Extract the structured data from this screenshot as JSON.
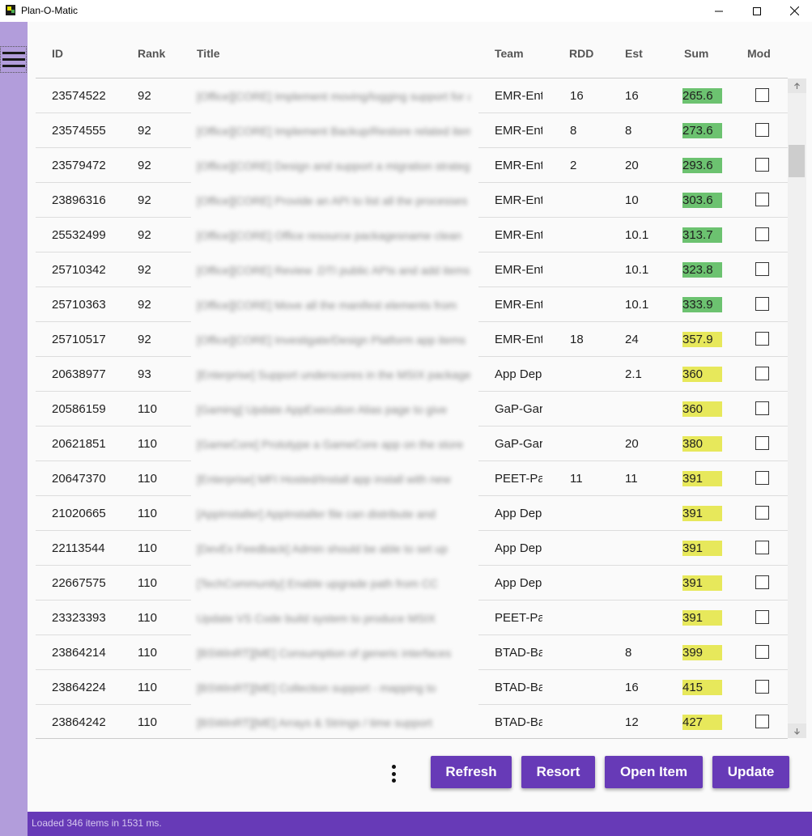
{
  "window": {
    "title": "Plan-O-Matic"
  },
  "columns": {
    "id": "ID",
    "rank": "Rank",
    "title": "Title",
    "team": "Team",
    "rdd": "RDD",
    "est": "Est",
    "sum": "Sum",
    "mod": "Mod"
  },
  "colors": {
    "accent": "#673ab7",
    "sidebar": "#b29ddb",
    "sum_green": "#6cc270",
    "sum_yellow": "#e7e85b"
  },
  "rows": [
    {
      "id": "23574522",
      "rank": "92",
      "title": "[Office][CORE] Implement moving/logging support for all",
      "team": "EMR-Ent",
      "rdd": "16",
      "est": "16",
      "sum": "265.6",
      "sum_color": "green",
      "mod": false
    },
    {
      "id": "23574555",
      "rank": "92",
      "title": "[Office][CORE] Implement Backup/Restore related items",
      "team": "EMR-Ent",
      "rdd": "8",
      "est": "8",
      "sum": "273.6",
      "sum_color": "green",
      "mod": false
    },
    {
      "id": "23579472",
      "rank": "92",
      "title": "[Office][CORE] Design and support a migration strategy",
      "team": "EMR-Ent",
      "rdd": "2",
      "est": "20",
      "sum": "293.6",
      "sum_color": "green",
      "mod": false
    },
    {
      "id": "23896316",
      "rank": "92",
      "title": "[Office][CORE] Provide an API to list all the processes",
      "team": "EMR-Ent",
      "rdd": "",
      "est": "10",
      "sum": "303.6",
      "sum_color": "green",
      "mod": false
    },
    {
      "id": "25532499",
      "rank": "92",
      "title": "[Office][CORE] Office resource packagesname clean",
      "team": "EMR-Ent",
      "rdd": "",
      "est": "10.1",
      "sum": "313.7",
      "sum_color": "green",
      "mod": false
    },
    {
      "id": "25710342",
      "rank": "92",
      "title": "[Office][CORE] Review .DTI public APIs and add items",
      "team": "EMR-Ent",
      "rdd": "",
      "est": "10.1",
      "sum": "323.8",
      "sum_color": "green",
      "mod": false
    },
    {
      "id": "25710363",
      "rank": "92",
      "title": "[Office][CORE] Move all the manifest elements from",
      "team": "EMR-Ent",
      "rdd": "",
      "est": "10.1",
      "sum": "333.9",
      "sum_color": "green",
      "mod": false
    },
    {
      "id": "25710517",
      "rank": "92",
      "title": "[Office][CORE] Investigate/Design Platform app items",
      "team": "EMR-Ent",
      "rdd": "18",
      "est": "24",
      "sum": "357.9",
      "sum_color": "yellow",
      "mod": false
    },
    {
      "id": "20638977",
      "rank": "93",
      "title": "[Enterprise] Support underscores in the MSIX package",
      "team": "App Dep",
      "rdd": "",
      "est": "2.1",
      "sum": "360",
      "sum_color": "yellow",
      "mod": false
    },
    {
      "id": "20586159",
      "rank": "110",
      "title": "[Gaming] Update AppExecution Alias page to give",
      "team": "GaP-Gar",
      "rdd": "",
      "est": "",
      "sum": "360",
      "sum_color": "yellow",
      "mod": false
    },
    {
      "id": "20621851",
      "rank": "110",
      "title": "[GameCore] Prototype a GameCore app on the store",
      "team": "GaP-Gar",
      "rdd": "",
      "est": "20",
      "sum": "380",
      "sum_color": "yellow",
      "mod": false
    },
    {
      "id": "20647370",
      "rank": "110",
      "title": "[Enterprise] MFI Hosted/Install app install with new",
      "team": "PEET-Pa",
      "rdd": "11",
      "est": "11",
      "sum": "391",
      "sum_color": "yellow",
      "mod": false
    },
    {
      "id": "21020665",
      "rank": "110",
      "title": "[AppInstaller] AppInstaller file can distribute and",
      "team": "App Dep",
      "rdd": "",
      "est": "",
      "sum": "391",
      "sum_color": "yellow",
      "mod": false
    },
    {
      "id": "22113544",
      "rank": "110",
      "title": "[DevEx Feedback] Admin should be able to set up",
      "team": "App Dep",
      "rdd": "",
      "est": "",
      "sum": "391",
      "sum_color": "yellow",
      "mod": false
    },
    {
      "id": "22667575",
      "rank": "110",
      "title": "[TechCommunity] Enable upgrade path from CC",
      "team": "App Dep",
      "rdd": "",
      "est": "",
      "sum": "391",
      "sum_color": "yellow",
      "mod": false
    },
    {
      "id": "23323393",
      "rank": "110",
      "title": "Update VS Code build system to produce MSIX",
      "team": "PEET-Pa",
      "rdd": "",
      "est": "",
      "sum": "391",
      "sum_color": "yellow",
      "mod": false
    },
    {
      "id": "23864214",
      "rank": "110",
      "title": "[BSWinRT][ME] Consumption of generic interfaces",
      "team": "BTAD-Ba",
      "rdd": "",
      "est": "8",
      "sum": "399",
      "sum_color": "yellow",
      "mod": false
    },
    {
      "id": "23864224",
      "rank": "110",
      "title": "[BSWinRT][ME] Collection support - mapping to",
      "team": "BTAD-Ba",
      "rdd": "",
      "est": "16",
      "sum": "415",
      "sum_color": "yellow",
      "mod": false
    },
    {
      "id": "23864242",
      "rank": "110",
      "title": "[BSWinRT][ME] Arrays & Strings / time support",
      "team": "BTAD-Ba",
      "rdd": "",
      "est": "12",
      "sum": "427",
      "sum_color": "yellow",
      "mod": false
    }
  ],
  "buttons": {
    "refresh": "Refresh",
    "resort": "Resort",
    "open_item": "Open Item",
    "update": "Update"
  },
  "status": {
    "text": "Loaded 346 items in 1531 ms."
  }
}
